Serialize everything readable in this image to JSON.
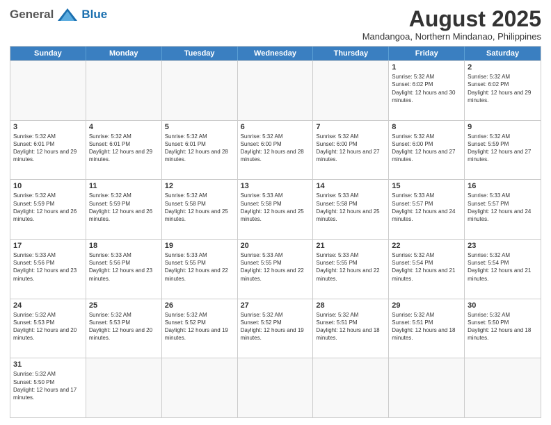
{
  "header": {
    "logo_general": "General",
    "logo_blue": "Blue",
    "title": "August 2025",
    "subtitle": "Mandangoa, Northern Mindanao, Philippines"
  },
  "days_of_week": [
    "Sunday",
    "Monday",
    "Tuesday",
    "Wednesday",
    "Thursday",
    "Friday",
    "Saturday"
  ],
  "weeks": [
    [
      {
        "day": "",
        "text": ""
      },
      {
        "day": "",
        "text": ""
      },
      {
        "day": "",
        "text": ""
      },
      {
        "day": "",
        "text": ""
      },
      {
        "day": "",
        "text": ""
      },
      {
        "day": "1",
        "text": "Sunrise: 5:32 AM\nSunset: 6:02 PM\nDaylight: 12 hours and 30 minutes."
      },
      {
        "day": "2",
        "text": "Sunrise: 5:32 AM\nSunset: 6:02 PM\nDaylight: 12 hours and 29 minutes."
      }
    ],
    [
      {
        "day": "3",
        "text": "Sunrise: 5:32 AM\nSunset: 6:01 PM\nDaylight: 12 hours and 29 minutes."
      },
      {
        "day": "4",
        "text": "Sunrise: 5:32 AM\nSunset: 6:01 PM\nDaylight: 12 hours and 29 minutes."
      },
      {
        "day": "5",
        "text": "Sunrise: 5:32 AM\nSunset: 6:01 PM\nDaylight: 12 hours and 28 minutes."
      },
      {
        "day": "6",
        "text": "Sunrise: 5:32 AM\nSunset: 6:00 PM\nDaylight: 12 hours and 28 minutes."
      },
      {
        "day": "7",
        "text": "Sunrise: 5:32 AM\nSunset: 6:00 PM\nDaylight: 12 hours and 27 minutes."
      },
      {
        "day": "8",
        "text": "Sunrise: 5:32 AM\nSunset: 6:00 PM\nDaylight: 12 hours and 27 minutes."
      },
      {
        "day": "9",
        "text": "Sunrise: 5:32 AM\nSunset: 5:59 PM\nDaylight: 12 hours and 27 minutes."
      }
    ],
    [
      {
        "day": "10",
        "text": "Sunrise: 5:32 AM\nSunset: 5:59 PM\nDaylight: 12 hours and 26 minutes."
      },
      {
        "day": "11",
        "text": "Sunrise: 5:32 AM\nSunset: 5:59 PM\nDaylight: 12 hours and 26 minutes."
      },
      {
        "day": "12",
        "text": "Sunrise: 5:32 AM\nSunset: 5:58 PM\nDaylight: 12 hours and 25 minutes."
      },
      {
        "day": "13",
        "text": "Sunrise: 5:33 AM\nSunset: 5:58 PM\nDaylight: 12 hours and 25 minutes."
      },
      {
        "day": "14",
        "text": "Sunrise: 5:33 AM\nSunset: 5:58 PM\nDaylight: 12 hours and 25 minutes."
      },
      {
        "day": "15",
        "text": "Sunrise: 5:33 AM\nSunset: 5:57 PM\nDaylight: 12 hours and 24 minutes."
      },
      {
        "day": "16",
        "text": "Sunrise: 5:33 AM\nSunset: 5:57 PM\nDaylight: 12 hours and 24 minutes."
      }
    ],
    [
      {
        "day": "17",
        "text": "Sunrise: 5:33 AM\nSunset: 5:56 PM\nDaylight: 12 hours and 23 minutes."
      },
      {
        "day": "18",
        "text": "Sunrise: 5:33 AM\nSunset: 5:56 PM\nDaylight: 12 hours and 23 minutes."
      },
      {
        "day": "19",
        "text": "Sunrise: 5:33 AM\nSunset: 5:55 PM\nDaylight: 12 hours and 22 minutes."
      },
      {
        "day": "20",
        "text": "Sunrise: 5:33 AM\nSunset: 5:55 PM\nDaylight: 12 hours and 22 minutes."
      },
      {
        "day": "21",
        "text": "Sunrise: 5:33 AM\nSunset: 5:55 PM\nDaylight: 12 hours and 22 minutes."
      },
      {
        "day": "22",
        "text": "Sunrise: 5:32 AM\nSunset: 5:54 PM\nDaylight: 12 hours and 21 minutes."
      },
      {
        "day": "23",
        "text": "Sunrise: 5:32 AM\nSunset: 5:54 PM\nDaylight: 12 hours and 21 minutes."
      }
    ],
    [
      {
        "day": "24",
        "text": "Sunrise: 5:32 AM\nSunset: 5:53 PM\nDaylight: 12 hours and 20 minutes."
      },
      {
        "day": "25",
        "text": "Sunrise: 5:32 AM\nSunset: 5:53 PM\nDaylight: 12 hours and 20 minutes."
      },
      {
        "day": "26",
        "text": "Sunrise: 5:32 AM\nSunset: 5:52 PM\nDaylight: 12 hours and 19 minutes."
      },
      {
        "day": "27",
        "text": "Sunrise: 5:32 AM\nSunset: 5:52 PM\nDaylight: 12 hours and 19 minutes."
      },
      {
        "day": "28",
        "text": "Sunrise: 5:32 AM\nSunset: 5:51 PM\nDaylight: 12 hours and 18 minutes."
      },
      {
        "day": "29",
        "text": "Sunrise: 5:32 AM\nSunset: 5:51 PM\nDaylight: 12 hours and 18 minutes."
      },
      {
        "day": "30",
        "text": "Sunrise: 5:32 AM\nSunset: 5:50 PM\nDaylight: 12 hours and 18 minutes."
      }
    ],
    [
      {
        "day": "31",
        "text": "Sunrise: 5:32 AM\nSunset: 5:50 PM\nDaylight: 12 hours and 17 minutes."
      },
      {
        "day": "",
        "text": ""
      },
      {
        "day": "",
        "text": ""
      },
      {
        "day": "",
        "text": ""
      },
      {
        "day": "",
        "text": ""
      },
      {
        "day": "",
        "text": ""
      },
      {
        "day": "",
        "text": ""
      }
    ]
  ]
}
